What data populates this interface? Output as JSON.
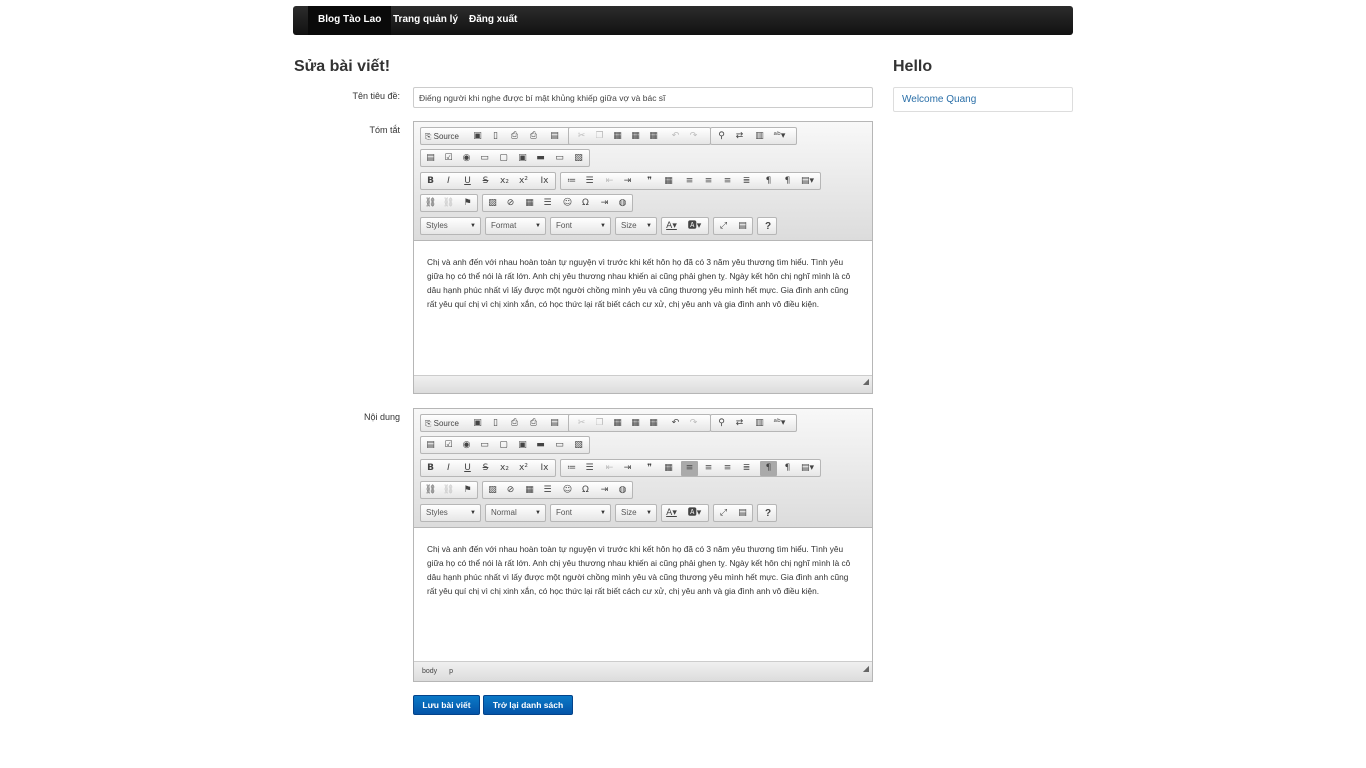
{
  "navbar": {
    "items": [
      {
        "label": "Blog Tào Lao"
      },
      {
        "label": "Trang quản lý"
      },
      {
        "label": "Đăng xuất"
      }
    ]
  },
  "page_title": "Sửa bài viết!",
  "sidebar": {
    "title": "Hello",
    "welcome": "Welcome Quang"
  },
  "form": {
    "title_label": "Tên tiêu đề:",
    "title_value": "Điếng người khi nghe được bí mật khủng khiếp giữa vợ và bác sĩ",
    "summary_label": "Tóm tắt",
    "content_label": "Nội dung",
    "summary_text": "Chị và anh đến với nhau hoàn toàn tự nguyện vì trước khi kết hôn họ đã có 3 năm yêu thương tìm hiểu. Tình yêu giữa họ có thể nói là rất lớn. Anh chị yêu thương nhau khiến ai cũng phải ghen tỵ. Ngày kết hôn chị nghĩ mình là cô dâu hạnh phúc nhất vì lấy được một người chồng mình yêu và cũng thương yêu mình hết mực. Gia đình anh cũng rất yêu quí chị vì chị xinh xắn, có học thức lại rất biết cách cư xử, chị yêu anh và gia đình anh vô điều kiện.",
    "content_text": "Chị và anh đến với nhau hoàn toàn tự nguyện vì trước khi kết hôn họ đã có 3 năm yêu thương tìm hiểu. Tình yêu giữa họ có thể nói là rất lớn. Anh chị yêu thương nhau khiến ai cũng phải ghen tỵ. Ngày kết hôn chị nghĩ mình là cô dâu hạnh phúc nhất vì lấy được một người chồng mình yêu và cũng thương yêu mình hết mực. Gia đình anh cũng rất yêu quí chị vì chị xinh xắn, có học thức lại rất biết cách cư xử, chị yêu anh và gia đình anh vô điều kiện.",
    "save_label": "Lưu bài viết",
    "back_label": "Trở lại danh sách"
  },
  "editor": {
    "source_label": "Source",
    "styles_label": "Styles",
    "summary_format_label": "Format",
    "content_format_label": "Normal",
    "font_label": "Font",
    "size_label": "Size",
    "help_label": "?",
    "path_body": "body",
    "path_p": "p"
  },
  "colors": {
    "navbar": "#1a1a1a",
    "primary_button": "#0867b8",
    "link": "#2a6fa8"
  }
}
